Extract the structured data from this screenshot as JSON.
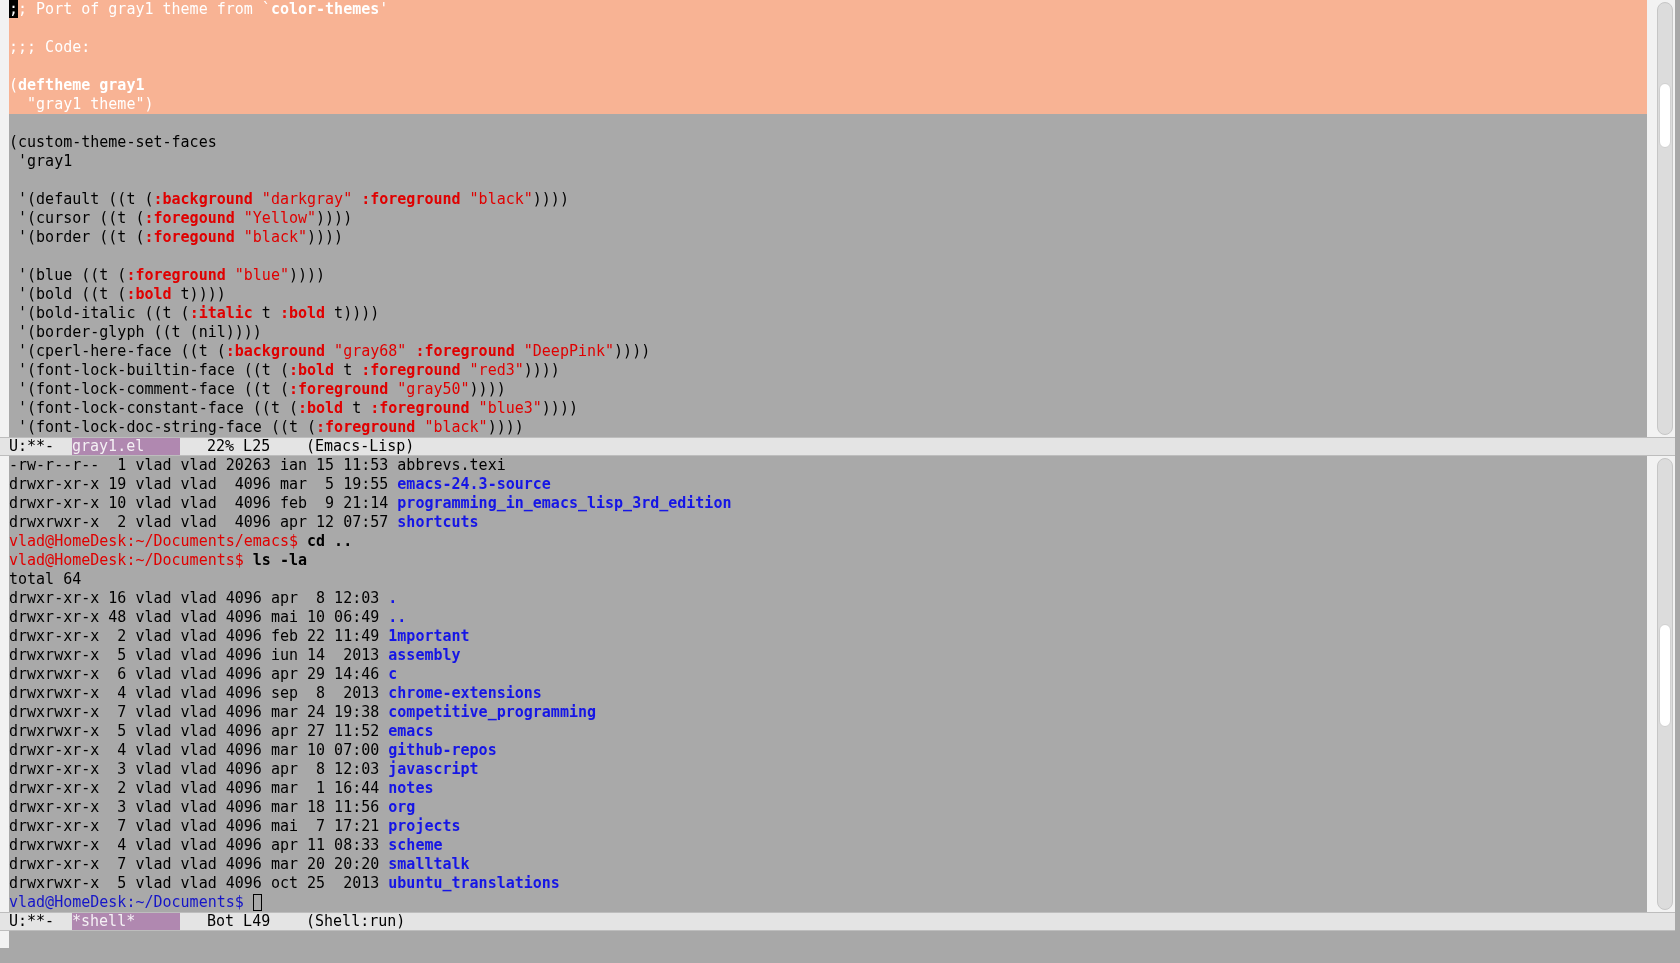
{
  "top_window": {
    "lines": [
      {
        "highlighted": true,
        "segments": [
          {
            "kind": "cursor",
            "text": ";"
          },
          {
            "kind": "plain",
            "text": "; Port of gray1 theme from `"
          },
          {
            "kind": "bold",
            "text": "color-themes"
          },
          {
            "kind": "plain",
            "text": "'"
          }
        ]
      },
      {
        "highlighted": true
      },
      {
        "highlighted": true,
        "segments": [
          {
            "kind": "plain",
            "text": ";;; Code:"
          }
        ]
      },
      {
        "highlighted": true
      },
      {
        "highlighted": true,
        "segments": [
          {
            "kind": "plain",
            "text": "("
          },
          {
            "kind": "bold",
            "text": "deftheme gray1"
          }
        ]
      },
      {
        "highlighted": true,
        "segments": [
          {
            "kind": "plain",
            "text": "  \"gray1 theme\")"
          }
        ]
      },
      {
        "highlighted": false
      },
      {
        "highlighted": false,
        "segments": [
          {
            "kind": "plain",
            "text": "(custom-theme-set-faces"
          }
        ]
      },
      {
        "highlighted": false,
        "segments": [
          {
            "kind": "plain",
            "text": " 'gray1"
          }
        ]
      },
      {
        "highlighted": false
      },
      {
        "highlighted": false,
        "segments": [
          {
            "kind": "plain",
            "text": " '(default ((t ("
          },
          {
            "kind": "keyword",
            "text": ":background"
          },
          {
            "kind": "string",
            "text": " \"darkgray\" "
          },
          {
            "kind": "keyword",
            "text": ":foreground"
          },
          {
            "kind": "string",
            "text": " \"black\""
          },
          {
            "kind": "plain",
            "text": "))))"
          }
        ]
      },
      {
        "highlighted": false,
        "segments": [
          {
            "kind": "plain",
            "text": " '(cursor ((t ("
          },
          {
            "kind": "keyword",
            "text": ":foregound"
          },
          {
            "kind": "string",
            "text": " \"Yellow\""
          },
          {
            "kind": "plain",
            "text": "))))"
          }
        ]
      },
      {
        "highlighted": false,
        "segments": [
          {
            "kind": "plain",
            "text": " '(border ((t ("
          },
          {
            "kind": "keyword",
            "text": ":foregound"
          },
          {
            "kind": "string",
            "text": " \"black\""
          },
          {
            "kind": "plain",
            "text": "))))"
          }
        ]
      },
      {
        "highlighted": false
      },
      {
        "highlighted": false,
        "segments": [
          {
            "kind": "plain",
            "text": " '(blue ((t ("
          },
          {
            "kind": "keyword",
            "text": ":foreground"
          },
          {
            "kind": "string",
            "text": " \"blue\""
          },
          {
            "kind": "plain",
            "text": "))))"
          }
        ]
      },
      {
        "highlighted": false,
        "segments": [
          {
            "kind": "plain",
            "text": " '(bold ((t ("
          },
          {
            "kind": "keyword",
            "text": ":bold"
          },
          {
            "kind": "plain",
            "text": " t))))"
          }
        ]
      },
      {
        "highlighted": false,
        "segments": [
          {
            "kind": "plain",
            "text": " '(bold-italic ((t ("
          },
          {
            "kind": "keyword",
            "text": ":italic"
          },
          {
            "kind": "plain",
            "text": " t "
          },
          {
            "kind": "keyword",
            "text": ":bold"
          },
          {
            "kind": "plain",
            "text": " t))))"
          }
        ]
      },
      {
        "highlighted": false,
        "segments": [
          {
            "kind": "plain",
            "text": " '(border-glyph ((t (nil))))"
          }
        ]
      },
      {
        "highlighted": false,
        "segments": [
          {
            "kind": "plain",
            "text": " '(cperl-here-face ((t ("
          },
          {
            "kind": "keyword",
            "text": ":background"
          },
          {
            "kind": "string",
            "text": " \"gray68\" "
          },
          {
            "kind": "keyword",
            "text": ":foreground"
          },
          {
            "kind": "string",
            "text": " \"DeepPink\""
          },
          {
            "kind": "plain",
            "text": "))))"
          }
        ]
      },
      {
        "highlighted": false,
        "segments": [
          {
            "kind": "plain",
            "text": " '(font-lock-builtin-face ((t ("
          },
          {
            "kind": "keyword",
            "text": ":bold"
          },
          {
            "kind": "plain",
            "text": " t "
          },
          {
            "kind": "keyword",
            "text": ":foreground"
          },
          {
            "kind": "string",
            "text": " \"red3\""
          },
          {
            "kind": "plain",
            "text": "))))"
          }
        ]
      },
      {
        "highlighted": false,
        "segments": [
          {
            "kind": "plain",
            "text": " '(font-lock-comment-face ((t ("
          },
          {
            "kind": "keyword",
            "text": ":foreground"
          },
          {
            "kind": "string",
            "text": " \"gray50\""
          },
          {
            "kind": "plain",
            "text": "))))"
          }
        ]
      },
      {
        "highlighted": false,
        "segments": [
          {
            "kind": "plain",
            "text": " '(font-lock-constant-face ((t ("
          },
          {
            "kind": "keyword",
            "text": ":bold"
          },
          {
            "kind": "plain",
            "text": " t "
          },
          {
            "kind": "keyword",
            "text": ":foreground"
          },
          {
            "kind": "string",
            "text": " \"blue3\""
          },
          {
            "kind": "plain",
            "text": "))))"
          }
        ]
      },
      {
        "highlighted": false,
        "segments": [
          {
            "kind": "plain",
            "text": " '(font-lock-doc-string-face ((t ("
          },
          {
            "kind": "keyword",
            "text": ":foreground"
          },
          {
            "kind": "string",
            "text": " \"black\""
          },
          {
            "kind": "plain",
            "text": "))))"
          }
        ]
      }
    ],
    "modeline": {
      "state": "U:**-",
      "buffer": "gray1.el",
      "position": "22% L25",
      "mode": "(Emacs-Lisp)"
    }
  },
  "bottom_window": {
    "lines": [
      {
        "segments": [
          {
            "kind": "plain",
            "text": "-rw-r--r--  1 vlad vlad 20263 ian 15 11:53 abbrevs.texi"
          }
        ]
      },
      {
        "segments": [
          {
            "kind": "plain",
            "text": "drwxr-xr-x 19 vlad vlad  4096 mar  5 19:55 "
          },
          {
            "kind": "dir",
            "text": "emacs-24.3-source"
          }
        ]
      },
      {
        "segments": [
          {
            "kind": "plain",
            "text": "drwxr-xr-x 10 vlad vlad  4096 feb  9 21:14 "
          },
          {
            "kind": "dir",
            "text": "programming_in_emacs_lisp_3rd_edition"
          }
        ]
      },
      {
        "segments": [
          {
            "kind": "plain",
            "text": "drwxrwxr-x  2 vlad vlad  4096 apr 12 07:57 "
          },
          {
            "kind": "dir",
            "text": "shortcuts"
          }
        ]
      },
      {
        "segments": [
          {
            "kind": "prompt",
            "text": "vlad@HomeDesk:~/Documents/emacs$"
          },
          {
            "kind": "bold",
            "text": " cd .."
          }
        ]
      },
      {
        "segments": [
          {
            "kind": "prompt",
            "text": "vlad@HomeDesk:~/Documents$"
          },
          {
            "kind": "bold",
            "text": " ls -la"
          }
        ]
      },
      {
        "segments": [
          {
            "kind": "plain",
            "text": "total 64"
          }
        ]
      },
      {
        "segments": [
          {
            "kind": "plain",
            "text": "drwxr-xr-x 16 vlad vlad 4096 apr  8 12:03 "
          },
          {
            "kind": "dir",
            "text": "."
          }
        ]
      },
      {
        "segments": [
          {
            "kind": "plain",
            "text": "drwxr-xr-x 48 vlad vlad 4096 mai 10 06:49 "
          },
          {
            "kind": "dir",
            "text": ".."
          }
        ]
      },
      {
        "segments": [
          {
            "kind": "plain",
            "text": "drwxr-xr-x  2 vlad vlad 4096 feb 22 11:49 "
          },
          {
            "kind": "dir",
            "text": "1mportant"
          }
        ]
      },
      {
        "segments": [
          {
            "kind": "plain",
            "text": "drwxrwxr-x  5 vlad vlad 4096 iun 14  2013 "
          },
          {
            "kind": "dir",
            "text": "assembly"
          }
        ]
      },
      {
        "segments": [
          {
            "kind": "plain",
            "text": "drwxrwxr-x  6 vlad vlad 4096 apr 29 14:46 "
          },
          {
            "kind": "dir",
            "text": "c"
          }
        ]
      },
      {
        "segments": [
          {
            "kind": "plain",
            "text": "drwxrwxr-x  4 vlad vlad 4096 sep  8  2013 "
          },
          {
            "kind": "dir",
            "text": "chrome-extensions"
          }
        ]
      },
      {
        "segments": [
          {
            "kind": "plain",
            "text": "drwxrwxr-x  7 vlad vlad 4096 mar 24 19:38 "
          },
          {
            "kind": "dir",
            "text": "competitive_programming"
          }
        ]
      },
      {
        "segments": [
          {
            "kind": "plain",
            "text": "drwxrwxr-x  5 vlad vlad 4096 apr 27 11:52 "
          },
          {
            "kind": "dir",
            "text": "emacs"
          }
        ]
      },
      {
        "segments": [
          {
            "kind": "plain",
            "text": "drwxr-xr-x  4 vlad vlad 4096 mar 10 07:00 "
          },
          {
            "kind": "dir",
            "text": "github-repos"
          }
        ]
      },
      {
        "segments": [
          {
            "kind": "plain",
            "text": "drwxr-xr-x  3 vlad vlad 4096 apr  8 12:03 "
          },
          {
            "kind": "dir",
            "text": "javascript"
          }
        ]
      },
      {
        "segments": [
          {
            "kind": "plain",
            "text": "drwxr-xr-x  2 vlad vlad 4096 mar  1 16:44 "
          },
          {
            "kind": "dir",
            "text": "notes"
          }
        ]
      },
      {
        "segments": [
          {
            "kind": "plain",
            "text": "drwxr-xr-x  3 vlad vlad 4096 mar 18 11:56 "
          },
          {
            "kind": "dir",
            "text": "org"
          }
        ]
      },
      {
        "segments": [
          {
            "kind": "plain",
            "text": "drwxr-xr-x  7 vlad vlad 4096 mai  7 17:21 "
          },
          {
            "kind": "dir",
            "text": "projects"
          }
        ]
      },
      {
        "segments": [
          {
            "kind": "plain",
            "text": "drwxrwxr-x  4 vlad vlad 4096 apr 11 08:33 "
          },
          {
            "kind": "dir",
            "text": "scheme"
          }
        ]
      },
      {
        "segments": [
          {
            "kind": "plain",
            "text": "drwxr-xr-x  7 vlad vlad 4096 mar 20 20:20 "
          },
          {
            "kind": "dir",
            "text": "smalltalk"
          }
        ]
      },
      {
        "segments": [
          {
            "kind": "plain",
            "text": "drwxrwxr-x  5 vlad vlad 4096 oct 25  2013 "
          },
          {
            "kind": "dir",
            "text": "ubuntu_translations"
          }
        ]
      },
      {
        "segments": [
          {
            "kind": "prompt-current",
            "text": "vlad@HomeDesk:~/Documents$"
          },
          {
            "kind": "box-cursor"
          }
        ]
      }
    ],
    "modeline": {
      "state": "U:**-",
      "buffer": "*shell*",
      "position": "Bot L49",
      "mode": "(Shell:run)"
    }
  }
}
